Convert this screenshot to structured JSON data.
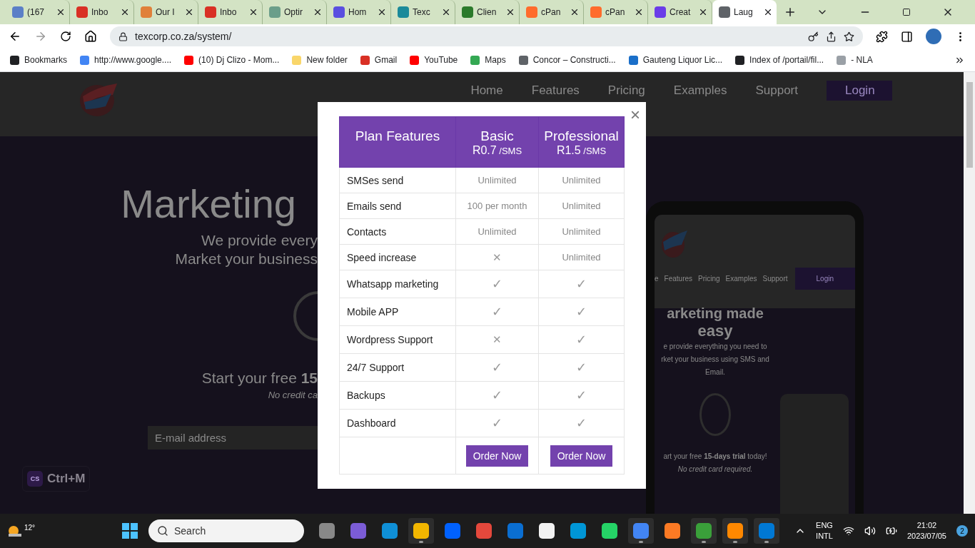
{
  "browser": {
    "tabs": [
      {
        "title": "(167",
        "selected": false,
        "color": "#5b7fc7"
      },
      {
        "title": "Inbo",
        "selected": false,
        "color": "#d93025"
      },
      {
        "title": "Our I",
        "selected": false,
        "color": "#e0803a"
      },
      {
        "title": "Inbo",
        "selected": false,
        "color": "#d93025"
      },
      {
        "title": "Optir",
        "selected": false,
        "color": "#6b9e8a"
      },
      {
        "title": "Hom",
        "selected": false,
        "color": "#5a4fe0"
      },
      {
        "title": "Texc",
        "selected": false,
        "color": "#1b8a9a"
      },
      {
        "title": "Clien",
        "selected": false,
        "color": "#2b7a2b"
      },
      {
        "title": "cPan",
        "selected": false,
        "color": "#ff6c2c"
      },
      {
        "title": "cPan",
        "selected": false,
        "color": "#ff6c2c"
      },
      {
        "title": "Creat",
        "selected": false,
        "color": "#6a3de8"
      },
      {
        "title": "Laug",
        "selected": true,
        "color": "#5f6368"
      }
    ],
    "address": "texcorp.co.za/system/",
    "bookmarks": [
      {
        "label": "Bookmarks",
        "color": "#202124"
      },
      {
        "label": "http://www.google....",
        "color": "#4285f4"
      },
      {
        "label": "(10) Dj Clizo - Mom...",
        "color": "#ff0000"
      },
      {
        "label": "New folder",
        "color": "#f9d66a"
      },
      {
        "label": "Gmail",
        "color": "#d93025"
      },
      {
        "label": "YouTube",
        "color": "#ff0000"
      },
      {
        "label": "Maps",
        "color": "#34a853"
      },
      {
        "label": "Concor – Constructi...",
        "color": "#5f6368"
      },
      {
        "label": "Gauteng Liquor Lic...",
        "color": "#1a6fc9"
      },
      {
        "label": "Index of /portail/fil...",
        "color": "#202124"
      },
      {
        "label": "- NLA",
        "color": "#9aa0a6"
      }
    ]
  },
  "page": {
    "nav": [
      "Home",
      "Features",
      "Pricing",
      "Examples",
      "Support"
    ],
    "login": "Login",
    "hero": {
      "title": "Marketing",
      "line_1": "We provide every",
      "line_2": "Market your business",
      "trial": "Start your free **15**",
      "note": "No credit ca",
      "email_placeholder": "E-mail address"
    },
    "extension": {
      "icon_text": "CS",
      "label": "Ctrl+M"
    },
    "mockup": {
      "nav": [
        "e",
        "Features",
        "Pricing",
        "Examples",
        "Support"
      ],
      "login": "Login",
      "title": "arketing made",
      "title_2": "easy",
      "lines": [
        "e provide everything you need to",
        "rket your business using SMS and",
        "Email."
      ],
      "trial": "art your free **15-days trial** today!",
      "note": "No credit card required."
    }
  },
  "modal": {
    "close": "×",
    "heading": "Plan Features",
    "plans": [
      {
        "name": "Basic",
        "price": "R0.7",
        "unit": "/SMS"
      },
      {
        "name": "Professional",
        "price": "R1.5",
        "unit": "/SMS"
      }
    ],
    "rows": [
      {
        "feature": "SMSes send",
        "cells": [
          {
            "kind": "text",
            "text": "Unlimited"
          },
          {
            "kind": "text",
            "text": "Unlimited"
          }
        ]
      },
      {
        "feature": "Emails send",
        "cells": [
          {
            "kind": "text",
            "text": "100 per month"
          },
          {
            "kind": "text",
            "text": "Unlimited"
          }
        ]
      },
      {
        "feature": "Contacts",
        "cells": [
          {
            "kind": "text",
            "text": "Unlimited"
          },
          {
            "kind": "text",
            "text": "Unlimited"
          }
        ]
      },
      {
        "feature": "Speed increase",
        "cells": [
          {
            "kind": "cross",
            "text": "✕"
          },
          {
            "kind": "text",
            "text": "Unlimited"
          }
        ]
      },
      {
        "feature": "Whatsapp marketing",
        "cells": [
          {
            "kind": "check",
            "text": "✓"
          },
          {
            "kind": "check",
            "text": "✓"
          }
        ]
      },
      {
        "feature": "Mobile APP",
        "cells": [
          {
            "kind": "check",
            "text": "✓"
          },
          {
            "kind": "check",
            "text": "✓"
          }
        ]
      },
      {
        "feature": "Wordpress Support",
        "cells": [
          {
            "kind": "cross",
            "text": "✕"
          },
          {
            "kind": "check",
            "text": "✓"
          }
        ]
      },
      {
        "feature": "24/7 Support",
        "cells": [
          {
            "kind": "check",
            "text": "✓"
          },
          {
            "kind": "check",
            "text": "✓"
          }
        ]
      },
      {
        "feature": "Backups",
        "cells": [
          {
            "kind": "check",
            "text": "✓"
          },
          {
            "kind": "check",
            "text": "✓"
          }
        ]
      },
      {
        "feature": "Dashboard",
        "cells": [
          {
            "kind": "check",
            "text": "✓"
          },
          {
            "kind": "check",
            "text": "✓"
          }
        ]
      }
    ],
    "buttons": [
      "Order Now",
      "Order Now"
    ]
  },
  "taskbar": {
    "weather": "12°",
    "search_placeholder": "Search",
    "apps": [
      {
        "color": "#888888",
        "active": false
      },
      {
        "color": "#7b5cd6",
        "active": false
      },
      {
        "color": "#0f8fd6",
        "active": false
      },
      {
        "color": "#f2b600",
        "active": true
      },
      {
        "color": "#0061fe",
        "active": false
      },
      {
        "color": "#e4483c",
        "active": false
      },
      {
        "color": "#0a6ed1",
        "active": false
      },
      {
        "color": "#f2f2f2",
        "active": false
      },
      {
        "color": "#0096d6",
        "active": false
      },
      {
        "color": "#25d366",
        "active": false
      },
      {
        "color": "#4285f4",
        "active": true
      },
      {
        "color": "#fb7a24",
        "active": false
      },
      {
        "color": "#3aa03a",
        "active": true
      },
      {
        "color": "#ff8800",
        "active": true
      },
      {
        "color": "#0078d4",
        "active": true
      }
    ],
    "language": "ENG",
    "layout": "INTL",
    "time": "21:02",
    "date": "2023/07/05",
    "notifications": "2"
  }
}
